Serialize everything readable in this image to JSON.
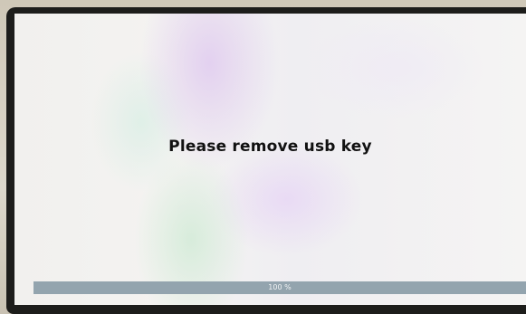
{
  "screen": {
    "message": "Please remove usb key"
  },
  "progress": {
    "label": "100 %",
    "fraction": 1.0
  },
  "colors": {
    "screen_background": "#f2f1ef",
    "progress_track": "#b8c2c8",
    "progress_fill": "#93a4ae",
    "message_text": "#111111"
  }
}
